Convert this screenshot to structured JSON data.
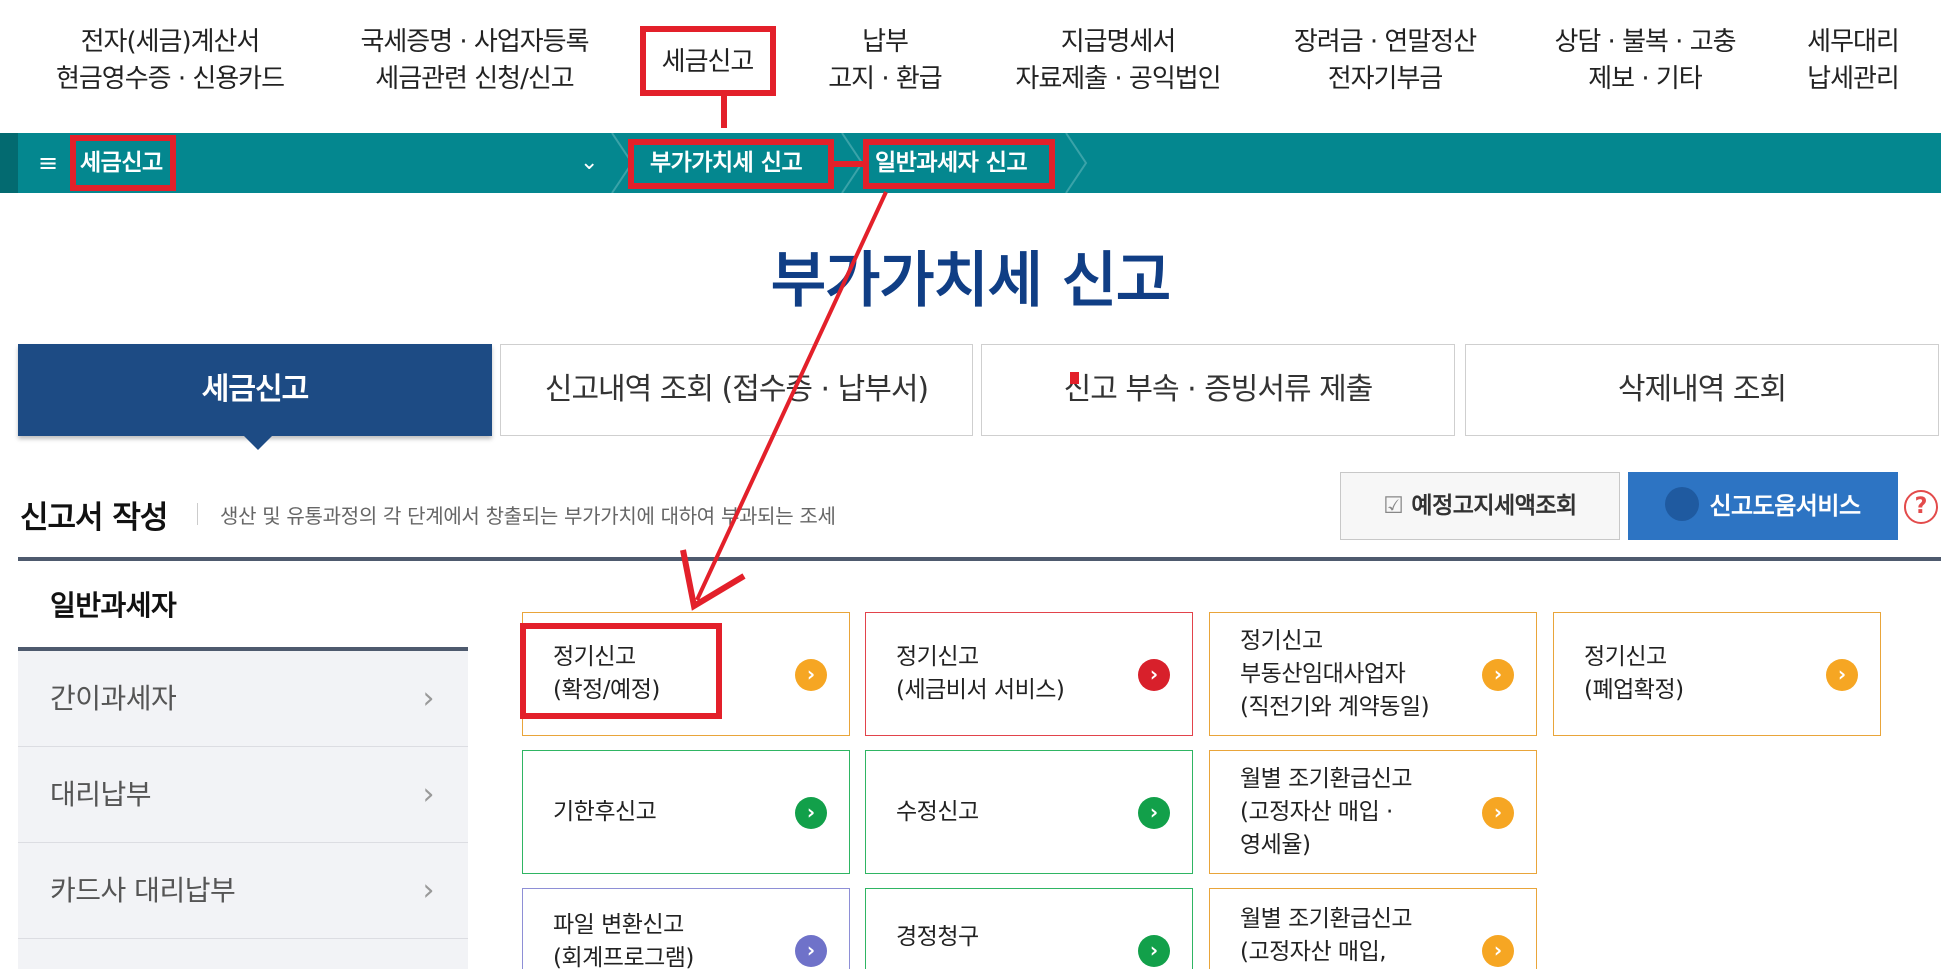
{
  "top_nav": [
    {
      "line1": "전자(세금)계산서",
      "line2": "현금영수증 · 신용카드"
    },
    {
      "line1": "국세증명 · 사업자등록",
      "line2": "세금관련 신청/신고"
    },
    {
      "line1": "세금신고",
      "line2": ""
    },
    {
      "line1": "납부",
      "line2": "고지 · 환급"
    },
    {
      "line1": "지급명세서",
      "line2": "자료제출 · 공익법인"
    },
    {
      "line1": "장려금 · 연말정산",
      "line2": "전자기부금"
    },
    {
      "line1": "상담 · 불복 · 고충",
      "line2": "제보 · 기타"
    },
    {
      "line1": "세무대리",
      "line2": "납세관리"
    }
  ],
  "breadcrumb": {
    "root": "세금신고",
    "level1": "부가가치세 신고",
    "level2": "일반과세자 신고"
  },
  "page_title": "부가가치세 신고",
  "tabs": [
    "세금신고",
    "신고내역 조회 (접수증 · 납부서)",
    "신고 부속 · 증빙서류 제출",
    "삭제내역 조회"
  ],
  "section": {
    "title": "신고서 작성",
    "description": "생산 및 유통과정의 각 단계에서 창출되는 부가가치에 대하여 부과되는 조세"
  },
  "buttons": {
    "estimate_lookup": "예정고지세액조회",
    "help_service": "신고도움서비스",
    "help_icon": "?"
  },
  "sidebar": [
    "일반과세자",
    "간이과세자",
    "대리납부",
    "카드사 대리납부"
  ],
  "cards": [
    {
      "lines": [
        "정기신고",
        "(확정/예정)"
      ],
      "color": "orange"
    },
    {
      "lines": [
        "정기신고",
        "(세금비서 서비스)"
      ],
      "color": "red"
    },
    {
      "lines": [
        "정기신고",
        "부동산임대사업자",
        "(직전기와 계약동일)"
      ],
      "color": "orange"
    },
    {
      "lines": [
        "정기신고",
        "(폐업확정)"
      ],
      "color": "orange"
    },
    {
      "lines": [
        "기한후신고"
      ],
      "color": "green"
    },
    {
      "lines": [
        "수정신고"
      ],
      "color": "green"
    },
    {
      "lines": [
        "월별 조기환급신고",
        "(고정자산 매입 ·",
        "영세율)"
      ],
      "color": "orange"
    },
    {
      "lines": [
        "파일 변환신고",
        "(회계프로그램)"
      ],
      "color": "purple"
    },
    {
      "lines": [
        "경정청구"
      ],
      "color": "green"
    },
    {
      "lines": [
        "월별 조기환급신고",
        "(고정자산 매입,"
      ],
      "color": "orange"
    }
  ],
  "colors": {
    "teal_bar": "#04878f",
    "navy": "#1d4b84",
    "title_blue": "#103e85",
    "primary_button": "#2d74c3",
    "annotation_red": "#e3202a"
  },
  "icons": [
    "hamburger-icon",
    "chevron-down-icon",
    "checkbox-icon",
    "book-icon",
    "help-icon",
    "chevron-right-icon"
  ]
}
